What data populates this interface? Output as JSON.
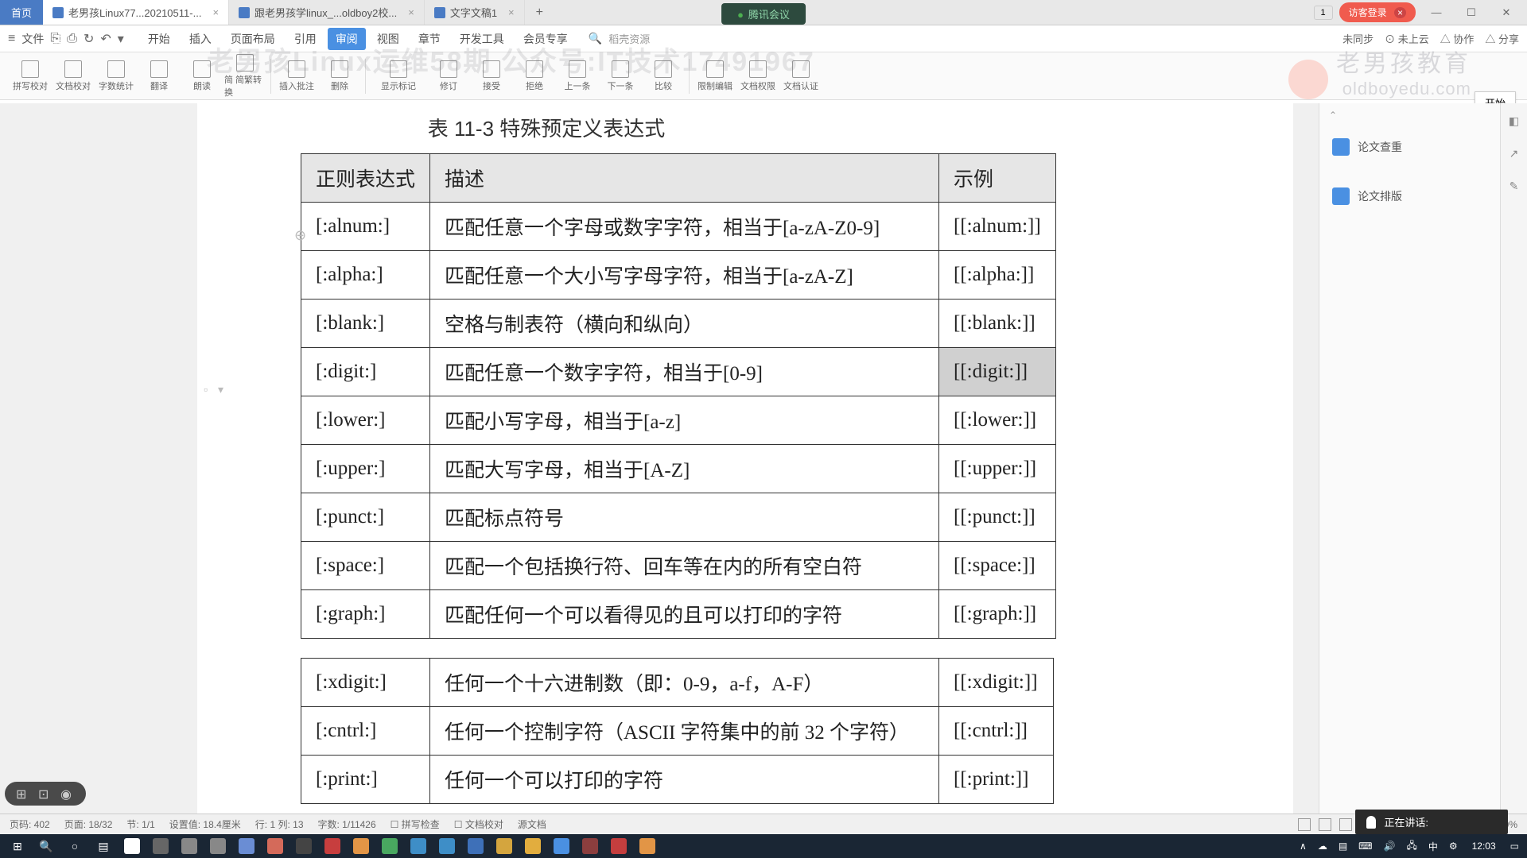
{
  "meeting_bar": "腾讯会议",
  "titlebar": {
    "home": "首页",
    "tab1": "老男孩Linux77...20210511-...",
    "tab2": "跟老男孩学linux_...oldboy2校...",
    "tab3": "文字文稿1",
    "close": "×",
    "add": "+",
    "badge": "1",
    "login": "访客登录",
    "login_badge": "×",
    "min": "—",
    "max": "☐",
    "x": "✕"
  },
  "menubar": {
    "ctrl_menu": "≡",
    "ctrl_file": "文件",
    "icons": [
      "⎘",
      "⎙",
      "↻",
      "↶",
      "▾"
    ],
    "items": [
      "开始",
      "插入",
      "页面布局",
      "引用",
      "审阅",
      "视图",
      "章节",
      "开发工具",
      "会员专享"
    ],
    "active_index": 4,
    "search_icon": "🔍",
    "search": "稻壳资源",
    "right": [
      "未同步",
      "⊙ 未上云",
      "△ 协作",
      "△ 分享"
    ]
  },
  "toolbar": {
    "buttons": [
      "拼写校对",
      "文档校对",
      "字数统计",
      "翻译",
      "朗读",
      "简 简繁转换",
      "插入批注",
      "删除",
      "显示标记",
      "修订",
      "接受",
      "拒绝",
      "上一条",
      "下一条",
      "比较",
      "限制编辑",
      "文档权限",
      "文档认证"
    ]
  },
  "watermark_text": "老男孩Linux运维58期 公众号:IT技术17491967",
  "watermark_brand": "老男孩教育",
  "watermark_domain": "oldboyedu.com",
  "start_float": "开始",
  "doc": {
    "title": "表 11-3  特殊预定义表达式",
    "headers": [
      "正则表达式",
      "描述",
      "示例"
    ],
    "rows": [
      {
        "c1": "[:alnum:]",
        "c2": "匹配任意一个字母或数字字符，相当于[a-zA-Z0-9]",
        "c3": "[[:alnum:]]"
      },
      {
        "c1": "[:alpha:]",
        "c2": "匹配任意一个大小写字母字符，相当于[a-zA-Z]",
        "c3": "[[:alpha:]]"
      },
      {
        "c1": "[:blank:]",
        "c2": "空格与制表符（横向和纵向）",
        "c3": "[[:blank:]]"
      },
      {
        "c1": "[:digit:]",
        "c2": "匹配任意一个数字字符，相当于[0-9]",
        "c3": "[[:digit:]]",
        "hl": true
      },
      {
        "c1": "[:lower:]",
        "c2": "匹配小写字母，相当于[a-z]",
        "c3": "[[:lower:]]"
      },
      {
        "c1": "[:upper:]",
        "c2": "匹配大写字母，相当于[A-Z]",
        "c3": "[[:upper:]]"
      },
      {
        "c1": "[:punct:]",
        "c2": "匹配标点符号",
        "c3": "[[:punct:]]"
      },
      {
        "c1": "[:space:]",
        "c2": "匹配一个包括换行符、回车等在内的所有空白符",
        "c3": "[[:space:]]"
      },
      {
        "c1": "[:graph:]",
        "c2": "匹配任何一个可以看得见的且可以打印的字符",
        "c3": "[[:graph:]]"
      }
    ],
    "rows2": [
      {
        "c1": "[:xdigit:]",
        "c2": "任何一个十六进制数（即：0-9，a-f，A-F）",
        "c3": "[[:xdigit:]]"
      },
      {
        "c1": "[:cntrl:]",
        "c2": "任何一个控制字符（ASCII 字符集中的前 32 个字符）",
        "c3": "[[:cntrl:]]"
      },
      {
        "c1": "[:print:]",
        "c2": "任何一个可以打印的字符",
        "c3": "[[:print:]]"
      }
    ]
  },
  "chart_data": {
    "type": "table",
    "title": "表 11-3  特殊预定义表达式",
    "columns": [
      "正则表达式",
      "描述",
      "示例"
    ],
    "rows": [
      [
        "[:alnum:]",
        "匹配任意一个字母或数字字符，相当于[a-zA-Z0-9]",
        "[[:alnum:]]"
      ],
      [
        "[:alpha:]",
        "匹配任意一个大小写字母字符，相当于[a-zA-Z]",
        "[[:alpha:]]"
      ],
      [
        "[:blank:]",
        "空格与制表符（横向和纵向）",
        "[[:blank:]]"
      ],
      [
        "[:digit:]",
        "匹配任意一个数字字符，相当于[0-9]",
        "[[:digit:]]"
      ],
      [
        "[:lower:]",
        "匹配小写字母，相当于[a-z]",
        "[[:lower:]]"
      ],
      [
        "[:upper:]",
        "匹配大写字母，相当于[A-Z]",
        "[[:upper:]]"
      ],
      [
        "[:punct:]",
        "匹配标点符号",
        "[[:punct:]]"
      ],
      [
        "[:space:]",
        "匹配一个包括换行符、回车等在内的所有空白符",
        "[[:space:]]"
      ],
      [
        "[:graph:]",
        "匹配任何一个可以看得见的且可以打印的字符",
        "[[:graph:]]"
      ],
      [
        "[:xdigit:]",
        "任何一个十六进制数（即：0-9，a-f，A-F）",
        "[[:xdigit:]]"
      ],
      [
        "[:cntrl:]",
        "任何一个控制字符（ASCII 字符集中的前 32 个字符）",
        "[[:cntrl:]]"
      ],
      [
        "[:print:]",
        "任何一个可以打印的字符",
        "[[:print:]]"
      ]
    ]
  },
  "sidebar": {
    "items": [
      "论文查重",
      "论文排版"
    ]
  },
  "statusbar": {
    "left": [
      "页码: 402",
      "页面: 18/32",
      "节: 1/1",
      "设置值: 18.4厘米",
      "行: 1  列: 13",
      "字数: 1/11426",
      "☐ 拼写检查",
      "☐ 文档校对",
      "源文档"
    ],
    "zoom": "100%",
    "zoom_sep": "—————○—————"
  },
  "mic_bar": "正在讲话:",
  "taskbar": {
    "apps_colors": [
      "#ffffff",
      "#666",
      "#888",
      "#888",
      "#6a8dd4",
      "#d46a5a",
      "#444",
      "#c73e3e",
      "#e29546",
      "#49a860",
      "#3e8ec7",
      "#3e8ec7",
      "#3e70b8",
      "#d4a53e",
      "#e2ad3e",
      "#4a90e2",
      "#8b3e3e",
      "#c43e3e",
      "#e29546"
    ],
    "right": [
      "∧",
      "☁",
      "▤",
      "⌨",
      "🔊",
      "🖧",
      "中",
      "⚙"
    ],
    "time": "12:03"
  }
}
